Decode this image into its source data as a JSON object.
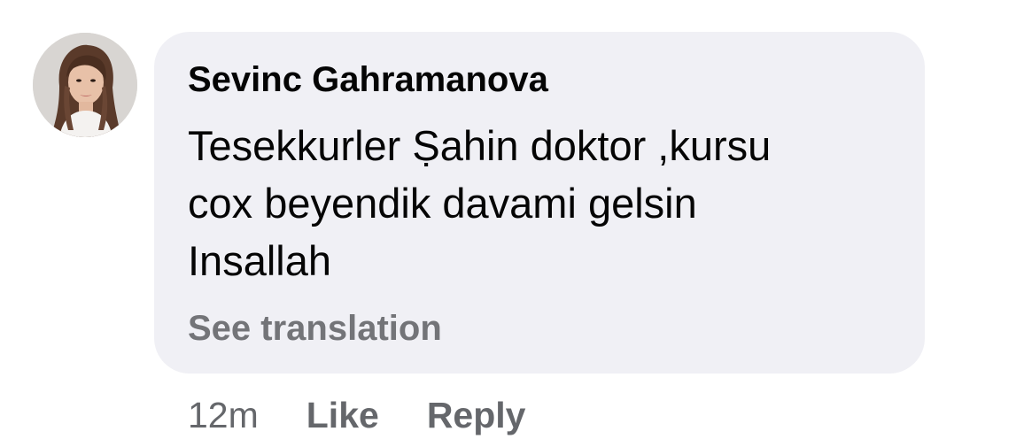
{
  "comment": {
    "author": "Sevinc Gahramanova",
    "text_lines": [
      "Tesekkurler Ṣahin doktor ,kursu",
      "cox beyendik davami gelsin",
      "Insallah"
    ],
    "translate_label": "See translation",
    "timestamp": "12m",
    "like_label": "Like",
    "reply_label": "Reply",
    "avatar_icon": "profile-photo"
  },
  "colors": {
    "bubble_background": "#f0f0f5",
    "text": "#050505",
    "muted_text": "#65676b"
  }
}
